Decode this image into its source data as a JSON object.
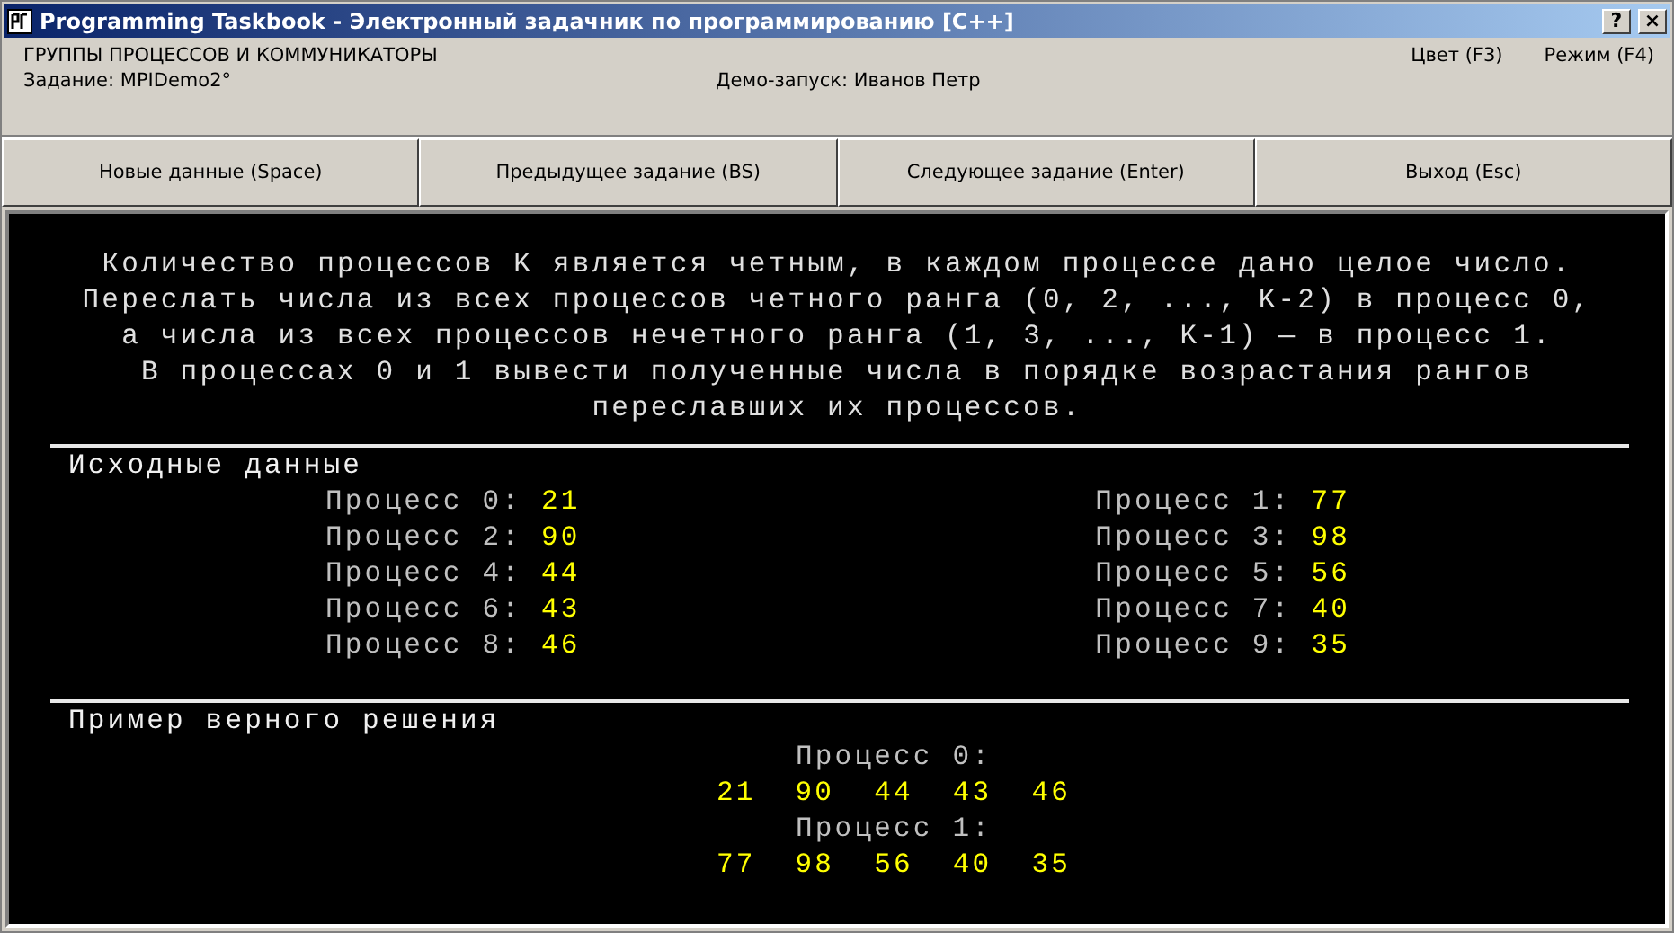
{
  "window": {
    "title": "Programming Taskbook - Электронный задачник по программированию [C++]",
    "controls": [
      "?",
      "×"
    ]
  },
  "header": {
    "group": "ГРУППЫ ПРОЦЕССОВ И КОММУНИКАТОРЫ",
    "task": "Задание: MPIDemo2°",
    "demo": "Демо-запуск: Иванов Петр",
    "color_menu": "Цвет (F3)",
    "mode": "Режим (F4)"
  },
  "buttons": [
    "Новые данные (Space)",
    "Предыдущее задание (BS)",
    "Следующее задание (Enter)",
    "Выход (Esc)"
  ],
  "statement": [
    "Количество процессов K является четным, в каждом процессе дано целое число.",
    "Переслать числа из всех процессов четного ранга (0, 2, ..., K-2) в процесс 0,",
    "а числа из всех процессов нечетного ранга (1, 3, ..., K-1) — в процесс 1.",
    "В процессах 0 и 1 вывести полученные числа в порядке возрастания рангов",
    "переславших их процессов."
  ],
  "input": {
    "title": "Исходные данные",
    "items": [
      {
        "label": "Процесс 0:",
        "value": "21"
      },
      {
        "label": "Процесс 1:",
        "value": "77"
      },
      {
        "label": "Процесс 2:",
        "value": "90"
      },
      {
        "label": "Процесс 3:",
        "value": "98"
      },
      {
        "label": "Процесс 4:",
        "value": "44"
      },
      {
        "label": "Процесс 5:",
        "value": "56"
      },
      {
        "label": "Процесс 6:",
        "value": "43"
      },
      {
        "label": "Процесс 7:",
        "value": "40"
      },
      {
        "label": "Процесс 8:",
        "value": "46"
      },
      {
        "label": "Процесс 9:",
        "value": "35"
      }
    ]
  },
  "example": {
    "title": "Пример верного решения",
    "groups": [
      {
        "label": "Процесс 0:",
        "values": [
          "21",
          "90",
          "44",
          "43",
          "46"
        ]
      },
      {
        "label": "Процесс 1:",
        "values": [
          "77",
          "98",
          "56",
          "40",
          "35"
        ]
      }
    ]
  }
}
